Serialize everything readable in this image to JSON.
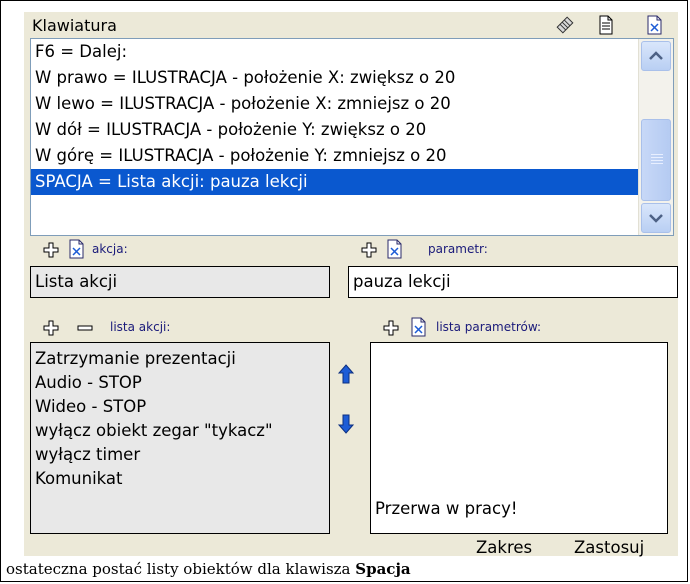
{
  "window": {
    "title": "Klawiatura"
  },
  "toolbar_icons": [
    "rubber-icon",
    "page-icon",
    "delete-file-icon"
  ],
  "shortcuts_list": {
    "items": [
      "F6 = Dalej:",
      "W prawo = ILUSTRACJA - położenie X: zwiększ o 20",
      "W lewo = ILUSTRACJA - położenie X: zmniejsz o 20",
      "W dół = ILUSTRACJA - położenie Y: zwiększ o 20",
      "W górę = ILUSTRACJA - położenie Y: zmniejsz o 20",
      "SPACJA = Lista akcji: pauza lekcji"
    ],
    "selected_index": 5
  },
  "action": {
    "label": "akcja:",
    "value": "Lista akcji"
  },
  "parameter": {
    "label": "parametr:",
    "value": "pauza lekcji"
  },
  "action_list": {
    "label": "lista akcji:",
    "items": [
      "Zatrzymanie prezentacji",
      "Audio - STOP",
      "Wideo - STOP",
      "wyłącz obiekt zegar \"tykacz\"",
      "wyłącz timer",
      "Komunikat"
    ]
  },
  "param_list": {
    "label": "lista parametrów:",
    "items": [
      "Przerwa w pracy!"
    ]
  },
  "buttons": {
    "range": "Zakres",
    "apply": "Zastosuj"
  },
  "caption": {
    "text": "ostateczna postać listy obiektów dla klawisza ",
    "bold": "Spacja"
  },
  "colors": {
    "panel": "#ece9d8",
    "selection": "#0a58cf",
    "label": "#1a1a7a",
    "arrow": "#1d5cd6"
  }
}
